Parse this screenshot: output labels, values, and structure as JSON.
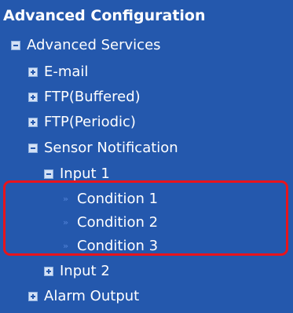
{
  "colors": {
    "background": "#2458ad",
    "text": "#ffffff",
    "highlight_border": "#e8141c"
  },
  "title": "Advanced Configuration",
  "tree": {
    "advanced_services": {
      "label": "Advanced Services",
      "icon": "minus-box-icon"
    },
    "email": {
      "label": "E-mail",
      "icon": "plus-box-icon"
    },
    "ftp_buffered": {
      "label": "FTP(Buffered)",
      "icon": "plus-box-icon"
    },
    "ftp_periodic": {
      "label": "FTP(Periodic)",
      "icon": "plus-box-icon"
    },
    "sensor_notification": {
      "label": "Sensor Notification",
      "icon": "minus-box-icon"
    },
    "input_1": {
      "label": "Input 1",
      "icon": "minus-box-icon"
    },
    "conditions": [
      {
        "label": "Condition 1",
        "icon": "double-arrow-icon"
      },
      {
        "label": "Condition 2",
        "icon": "double-arrow-icon"
      },
      {
        "label": "Condition 3",
        "icon": "double-arrow-icon"
      }
    ],
    "input_2": {
      "label": "Input 2",
      "icon": "plus-box-icon"
    },
    "alarm_output": {
      "label": "Alarm Output",
      "icon": "plus-box-icon"
    }
  }
}
